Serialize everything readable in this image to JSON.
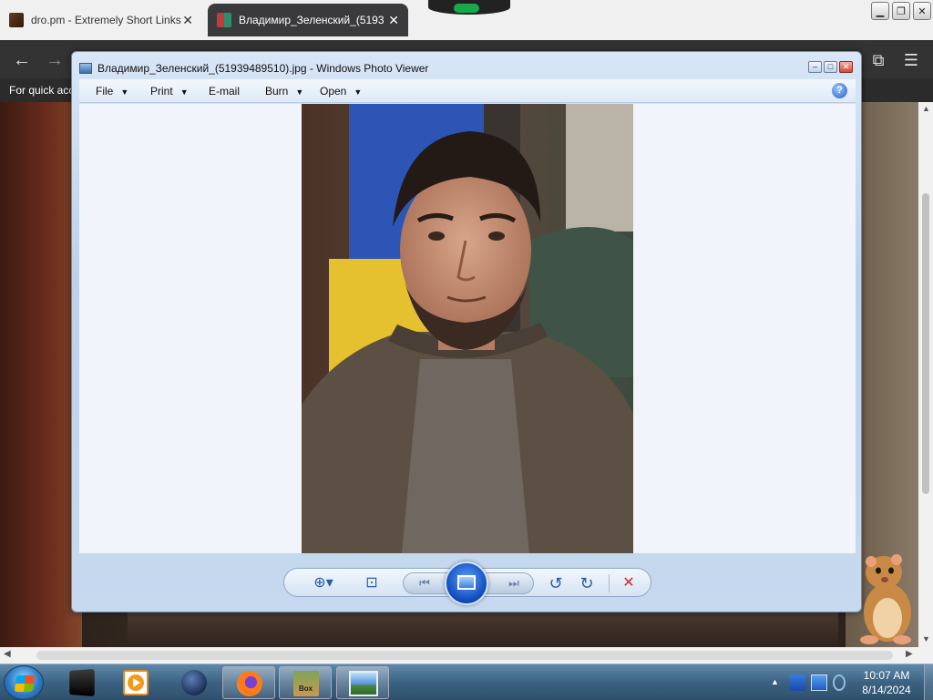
{
  "browser": {
    "tabs": [
      {
        "title": "dro.pm - Extremely Short Links",
        "close": "✕"
      },
      {
        "title": "Владимир_Зеленский_(5193",
        "close": "✕"
      }
    ],
    "window_controls": {
      "minimize": "▁",
      "restore": "❐",
      "close": "✕"
    },
    "nav": {
      "back": "←",
      "forward": "→",
      "extensions": "⧉",
      "menu": "☰"
    },
    "bookmarks_bar_text": "For quick acc",
    "scroll_arrows": {
      "left": "◀",
      "right": "▶",
      "up": "▲",
      "down": "▼"
    }
  },
  "photo_viewer": {
    "title": "Владимир_Зеленский_(51939489510).jpg - Windows Photo Viewer",
    "caption_buttons": {
      "minimize": "–",
      "maximize": "□",
      "close": "✕"
    },
    "menu": [
      {
        "label": "File",
        "caret": "▼"
      },
      {
        "label": "Print",
        "caret": "▼"
      },
      {
        "label": "E-mail",
        "caret": ""
      },
      {
        "label": "Burn",
        "caret": "▼"
      },
      {
        "label": "Open",
        "caret": "▼"
      }
    ],
    "help": "?",
    "controls": {
      "zoom": "⊕▾",
      "actual_size": "⊡",
      "previous": "⏮",
      "next": "⏭",
      "rotate_ccw": "↺",
      "rotate_cw": "↻",
      "delete": "✕"
    }
  },
  "taskbar": {
    "items": [
      {
        "icon": "terminal-icon",
        "active": false
      },
      {
        "icon": "media-player-icon",
        "active": false
      },
      {
        "icon": "globe-icon",
        "active": false
      },
      {
        "icon": "firefox-icon",
        "active": true
      },
      {
        "icon": "box-icon",
        "active": true,
        "label": "Box"
      },
      {
        "icon": "photo-viewer-icon",
        "active": true
      }
    ],
    "tray_expand": "▲",
    "clock": {
      "time": "10:07 AM",
      "date": "8/14/2024"
    }
  },
  "colors": {
    "accent": "#2a5ca8",
    "delete_red": "#d02a2a",
    "taskbar": "#3c6282"
  }
}
